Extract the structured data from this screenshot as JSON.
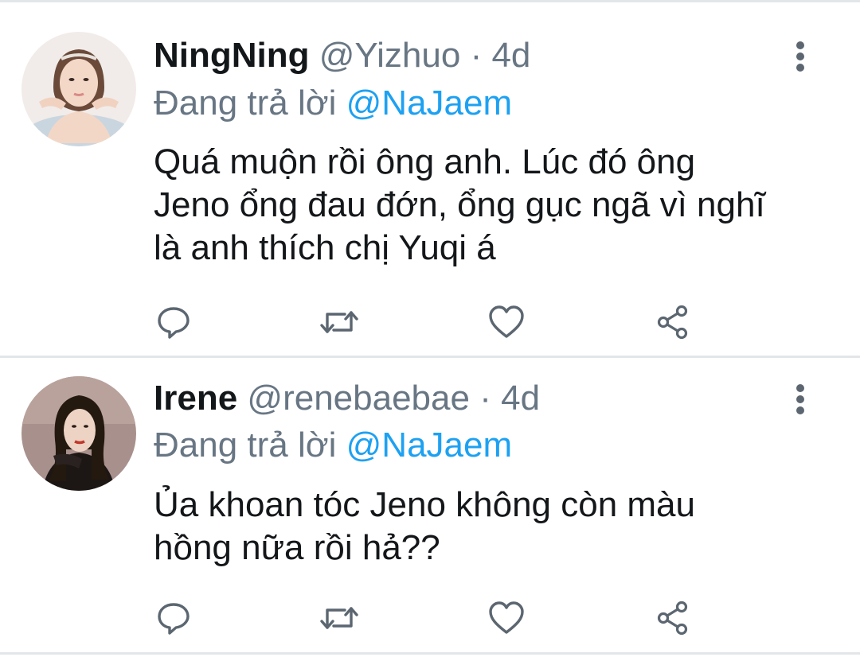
{
  "tweets": [
    {
      "display_name": "NingNing",
      "handle": "@Yizhuo",
      "separator": "·",
      "time": "4d",
      "reply_prefix": "Đang trả lời",
      "reply_to": "@NaJaem",
      "text": "Quá muộn rồi ông anh. Lúc đó ông Jeno ổng đau đớn, ổng gục ngã vì nghĩ là anh thích chị Yuqi á"
    },
    {
      "display_name": "Irene",
      "handle": "@renebaebae",
      "separator": "·",
      "time": "4d",
      "reply_prefix": "Đang trả lời",
      "reply_to": "@NaJaem",
      "text": "Ủa khoan tóc Jeno không còn màu hồng nữa rồi hả??"
    }
  ],
  "icons": {
    "more": "more-vertical-icon",
    "reply": "reply-icon",
    "retweet": "retweet-icon",
    "like": "heart-icon",
    "share": "share-icon"
  },
  "colors": {
    "text_primary": "#14171a",
    "text_secondary": "#687684",
    "link": "#1da1f2",
    "divider": "#e3e6e8"
  }
}
